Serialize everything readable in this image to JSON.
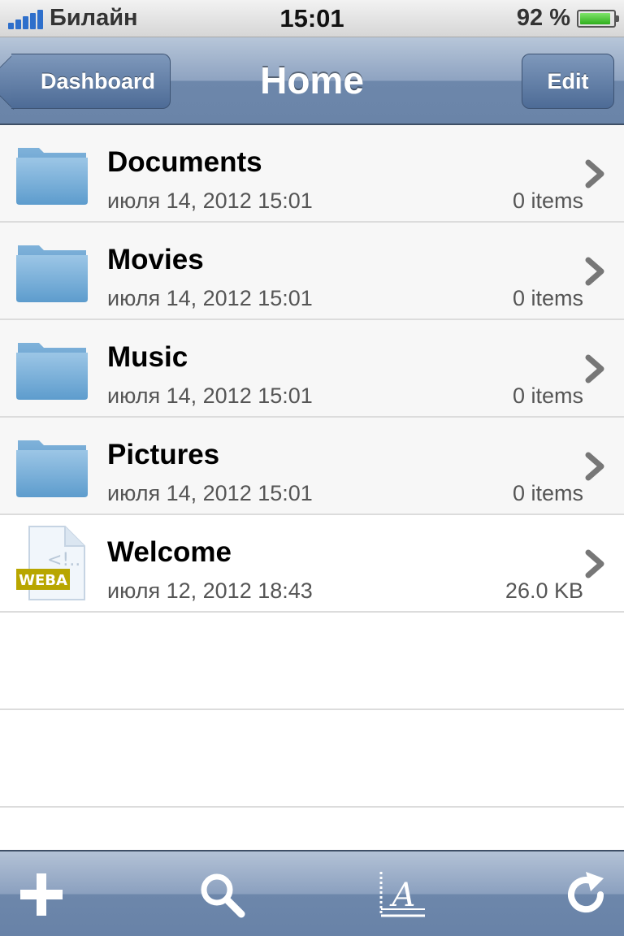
{
  "status_bar": {
    "carrier": "Билайн",
    "time": "15:01",
    "battery_percent": "92 %",
    "battery_level": 0.92
  },
  "nav": {
    "back_label": "Dashboard",
    "title": "Home",
    "edit_label": "Edit"
  },
  "items": [
    {
      "name": "Documents",
      "date": "июля 14, 2012 15:01",
      "size": "0 items",
      "icon": "folder-icon"
    },
    {
      "name": "Movies",
      "date": "июля 14, 2012 15:01",
      "size": "0 items",
      "icon": "folder-icon"
    },
    {
      "name": "Music",
      "date": "июля 14, 2012 15:01",
      "size": "0 items",
      "icon": "folder-icon"
    },
    {
      "name": "Pictures",
      "date": "июля 14, 2012 15:01",
      "size": "0 items",
      "icon": "folder-icon"
    },
    {
      "name": "Welcome",
      "date": "июля 12, 2012 18:43",
      "size": "26.0 KB",
      "icon": "weba-file-icon",
      "badge": "WEBA"
    }
  ],
  "toolbar": {
    "icons": [
      "plus-icon",
      "search-icon",
      "text-format-icon",
      "refresh-icon"
    ]
  },
  "colors": {
    "nav_bar": "#6d87ab",
    "signal": "#2e6fcb",
    "battery": "#2fae1c",
    "badge": "#b8a600"
  }
}
